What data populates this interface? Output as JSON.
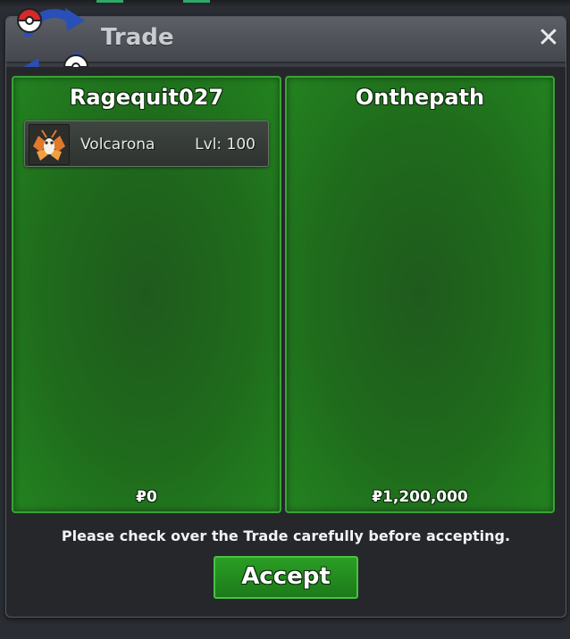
{
  "window": {
    "title": "Trade",
    "close_symbol": "✕",
    "logo_icon": "trade-swap-pokeball-icon"
  },
  "left_panel": {
    "trainer": "Ragequit027",
    "money": "₽0",
    "items": [
      {
        "name": "Volcarona",
        "level": "Lvl: 100",
        "icon": "volcarona-sprite-icon"
      }
    ]
  },
  "right_panel": {
    "trainer": "Onthepath",
    "money": "₽1,200,000",
    "items": []
  },
  "footer": {
    "notice": "Please check over the Trade carefully before accepting.",
    "accept_label": "Accept"
  },
  "colors": {
    "panel_green": "#1f6b1c",
    "panel_border": "#3aa336",
    "accept_green": "#2a9e25"
  }
}
